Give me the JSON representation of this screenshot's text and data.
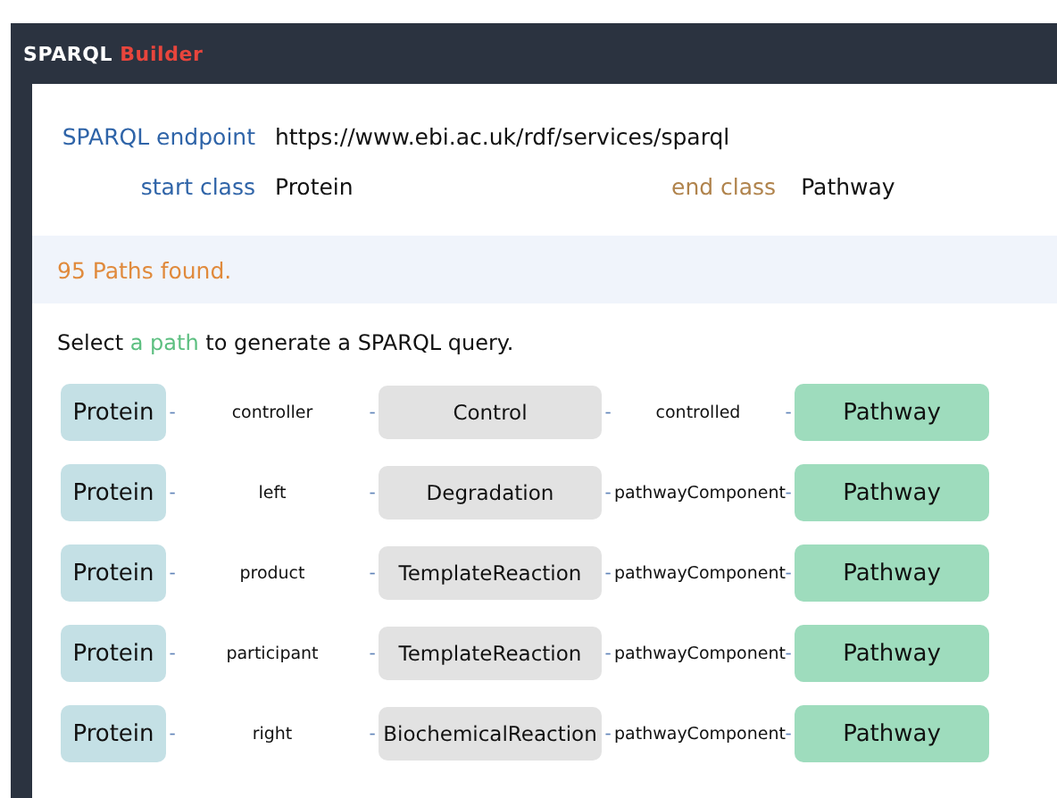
{
  "app": {
    "title_parts": [
      "SPARQL",
      "Builder"
    ]
  },
  "endpoint": {
    "label": "SPARQL endpoint",
    "value": "https://www.ebi.ac.uk/rdf/services/sparql"
  },
  "start_class": {
    "label": "start class",
    "value": "Protein"
  },
  "end_class": {
    "label": "end class",
    "value": "Pathway"
  },
  "status": "95 Paths found.",
  "instruction": "Select *a path* to generate a SPARQL query.",
  "paths": [
    {
      "start": "Protein",
      "link_1": "controller",
      "middle": "Control",
      "link_2": "controlled",
      "end": "Pathway",
      "connectors": [
        "-",
        "-",
        "-",
        "-"
      ]
    },
    {
      "start": "Protein",
      "link_1": "left",
      "middle": "Degradation",
      "link_2": "pathwayComponent",
      "end": "Pathway",
      "connectors": [
        "-",
        "-",
        "-",
        "-"
      ]
    },
    {
      "start": "Protein",
      "link_1": "product",
      "middle": "TemplateReaction",
      "link_2": "pathwayComponent",
      "end": "Pathway",
      "connectors": [
        "-",
        "-",
        "-",
        "-"
      ]
    },
    {
      "start": "Protein",
      "link_1": "participant",
      "middle": "TemplateReaction",
      "link_2": "pathwayComponent",
      "end": "Pathway",
      "connectors": [
        "-",
        "-",
        "-",
        "-"
      ]
    },
    {
      "start": "Protein",
      "link_1": "right",
      "middle": "BiochemicalReaction",
      "link_2": "pathwayComponent",
      "end": "Pathway",
      "connectors": [
        "-",
        "-",
        "-",
        "-"
      ]
    }
  ]
}
